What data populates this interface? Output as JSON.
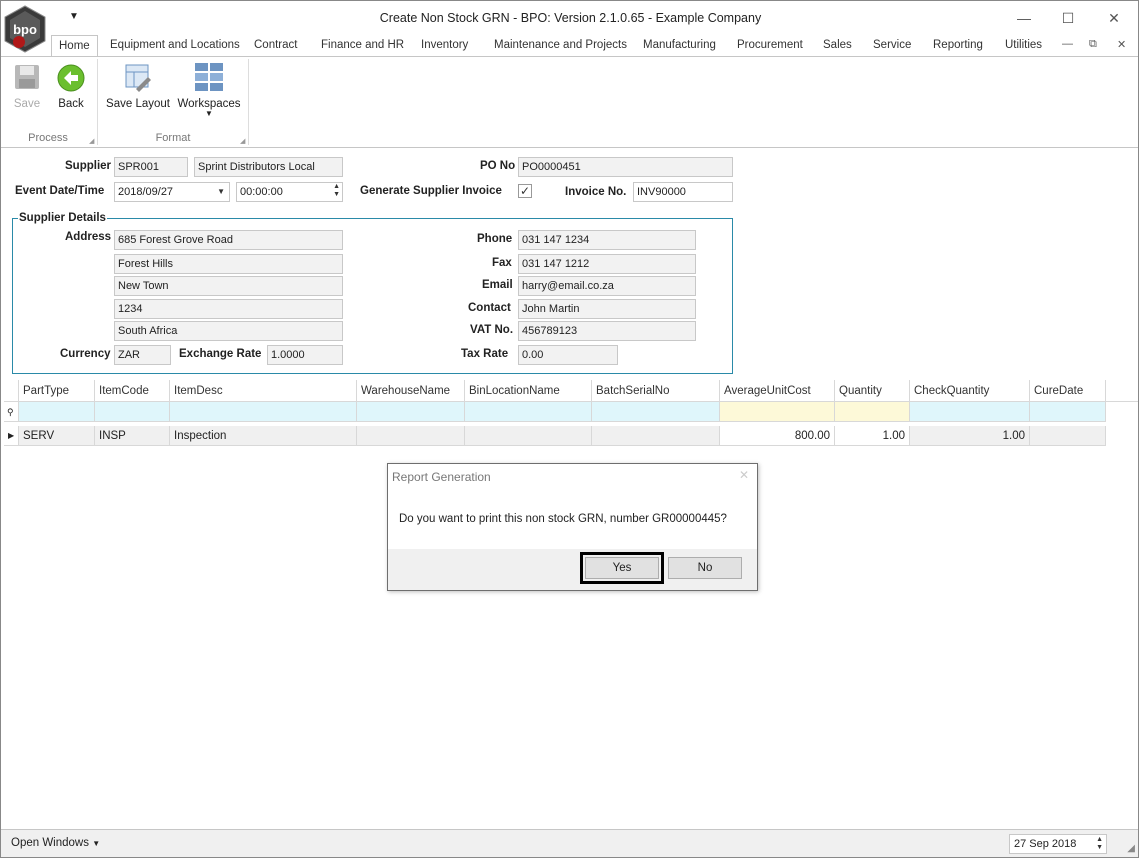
{
  "app": {
    "title": "Create Non Stock GRN - BPO: Version 2.1.0.65 - Example Company",
    "logo_text": "bpo"
  },
  "ribbon": {
    "tabs": [
      "Home",
      "Equipment and Locations",
      "Contract",
      "Finance and HR",
      "Inventory",
      "Maintenance and Projects",
      "Manufacturing",
      "Procurement",
      "Sales",
      "Service",
      "Reporting",
      "Utilities"
    ],
    "buttons": {
      "save": "Save",
      "back": "Back",
      "save_layout": "Save Layout",
      "workspaces": "Workspaces"
    },
    "groups": {
      "process": "Process",
      "format": "Format"
    }
  },
  "form": {
    "supplier_label": "Supplier",
    "supplier_code": "SPR001",
    "supplier_name": "Sprint Distributors Local",
    "event_label": "Event Date/Time",
    "event_date": "2018/09/27",
    "event_time": "00:00:00",
    "po_label": "PO No",
    "po_no": "PO0000451",
    "gen_invoice_label": "Generate Supplier Invoice",
    "gen_invoice_checked": true,
    "invoice_label": "Invoice No.",
    "invoice_no": "INV90000",
    "details_title": "Supplier Details",
    "address_label": "Address",
    "address_lines": [
      "685 Forest Grove Road",
      "Forest Hills",
      "New Town",
      "1234",
      "South Africa"
    ],
    "phone_label": "Phone",
    "phone": "031 147 1234",
    "fax_label": "Fax",
    "fax": "031 147 1212",
    "email_label": "Email",
    "email": "harry@email.co.za",
    "contact_label": "Contact",
    "contact": "John Martin",
    "vat_label": "VAT No.",
    "vat": "456789123",
    "currency_label": "Currency",
    "currency": "ZAR",
    "exchange_label": "Exchange Rate",
    "exchange_rate": "1.0000",
    "tax_label": "Tax Rate",
    "tax_rate": "0.00"
  },
  "grid": {
    "columns": [
      "PartType",
      "ItemCode",
      "ItemDesc",
      "WarehouseName",
      "BinLocationName",
      "BatchSerialNo",
      "AverageUnitCost",
      "Quantity",
      "CheckQuantity",
      "CureDate"
    ],
    "rows": [
      {
        "PartType": "SERV",
        "ItemCode": "INSP",
        "ItemDesc": "Inspection",
        "WarehouseName": "",
        "BinLocationName": "",
        "BatchSerialNo": "",
        "AverageUnitCost": "800.00",
        "Quantity": "1.00",
        "CheckQuantity": "1.00",
        "CureDate": ""
      }
    ]
  },
  "dialog": {
    "title": "Report Generation",
    "message": "Do you want to print this non stock GRN, number GR00000445?",
    "yes": "Yes",
    "no": "No"
  },
  "statusbar": {
    "open_windows": "Open Windows",
    "date": "27 Sep 2018"
  }
}
